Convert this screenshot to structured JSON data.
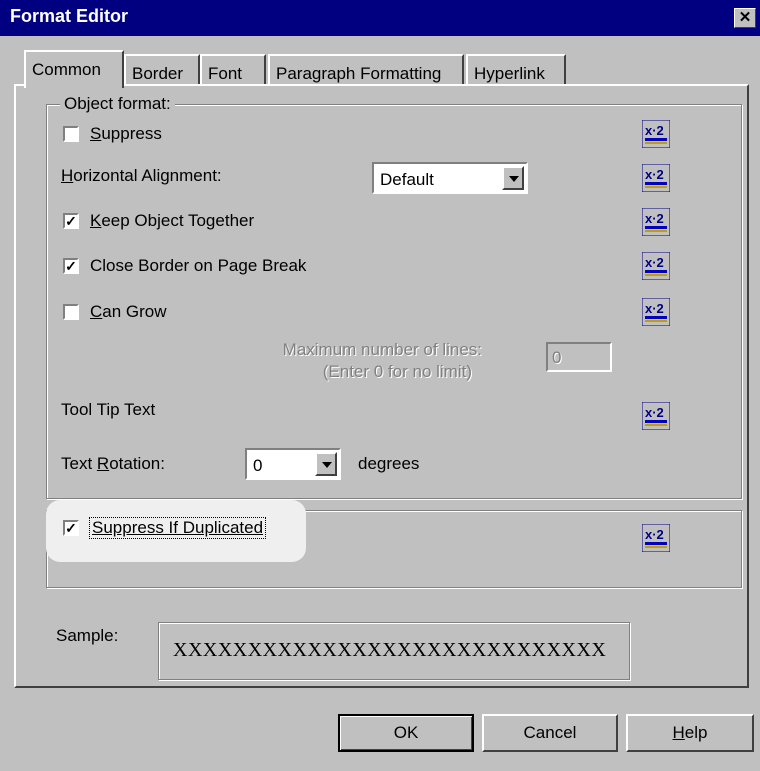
{
  "window": {
    "title": "Format Editor",
    "close_glyph": "✕"
  },
  "tabs": [
    {
      "label": "Common",
      "active": true
    },
    {
      "label": "Border",
      "active": false
    },
    {
      "label": "Font",
      "active": false
    },
    {
      "label": "Paragraph Formatting",
      "active": false
    },
    {
      "label": "Hyperlink",
      "active": false
    }
  ],
  "object_format": {
    "legend": "Object format:",
    "suppress": {
      "label_hotkey": "S",
      "label_rest": "uppress",
      "checked": false
    },
    "horizontal_alignment": {
      "label_hotkey": "H",
      "label_rest": "orizontal Alignment:",
      "value": "Default"
    },
    "keep_together": {
      "label_hotkey": "K",
      "label_rest": "eep Object Together",
      "checked": true
    },
    "close_border": {
      "label": "Close Border on Page Break",
      "checked": true
    },
    "can_grow": {
      "label_hotkey": "C",
      "label_rest": "an Grow",
      "checked": false
    },
    "max_lines": {
      "label_line1": "Maximum number of lines:",
      "label_line2": "(Enter 0 for no limit)",
      "value": "0"
    },
    "tooltip": {
      "label": "Tool Tip Text"
    },
    "text_rotation": {
      "label_prefix": "Text ",
      "label_hotkey": "R",
      "label_rest": "otation:",
      "value": "0",
      "unit": "degrees"
    }
  },
  "suppress_duplicated": {
    "label": "Suppress If Duplicated",
    "checked": true
  },
  "sample": {
    "label": "Sample:",
    "text": "XXXXXXXXXXXXXXXXXXXXXXXXXXXXX"
  },
  "buttons": {
    "ok": "OK",
    "cancel": "Cancel",
    "help_hotkey": "H",
    "help_rest": "elp"
  },
  "icons": {
    "formula": "formula-x2-icon",
    "dropdown": "dropdown-arrow-icon"
  },
  "colors": {
    "titlebar": "#000080",
    "face": "#c0c0c0",
    "highlight": "#ffffff",
    "shadow": "#808080"
  }
}
